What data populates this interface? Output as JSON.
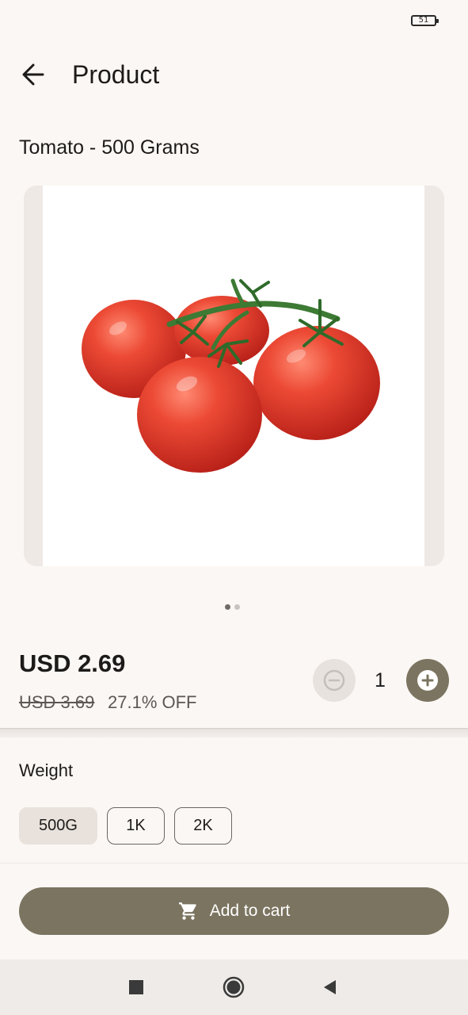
{
  "status_bar": {
    "battery_level": "51",
    "battery_icon": "battery-icon"
  },
  "app_bar": {
    "title": "Product",
    "back_icon": "arrow-back-icon"
  },
  "product": {
    "name": "Tomato - 500 Grams",
    "image": "tomato-vine-image",
    "carousel": {
      "total_images": 2,
      "current_index": 0
    }
  },
  "pricing": {
    "price": "USD 2.69",
    "original_price": "USD 3.69",
    "discount": "27.1% OFF"
  },
  "quantity": {
    "value": "1",
    "decrement_icon": "minus-circle-icon",
    "increment_icon": "plus-circle-icon",
    "decrement_enabled": false
  },
  "weight": {
    "label": "Weight",
    "options": [
      {
        "label": "500G",
        "selected": true
      },
      {
        "label": "1K",
        "selected": false
      },
      {
        "label": "2K",
        "selected": false
      }
    ]
  },
  "cart": {
    "label": "Add to cart",
    "icon": "shopping-cart-icon"
  },
  "nav_bar": {
    "recents_icon": "square-icon",
    "home_icon": "circle-icon",
    "back_icon": "triangle-back-icon"
  },
  "colors": {
    "background": "#fbf7f4",
    "accent": "#7b7460",
    "chip_selected": "#e9e2dc",
    "disabled_button": "#e7e2de",
    "tomato_red": "#e2372b",
    "stem_green": "#3d7a34"
  }
}
